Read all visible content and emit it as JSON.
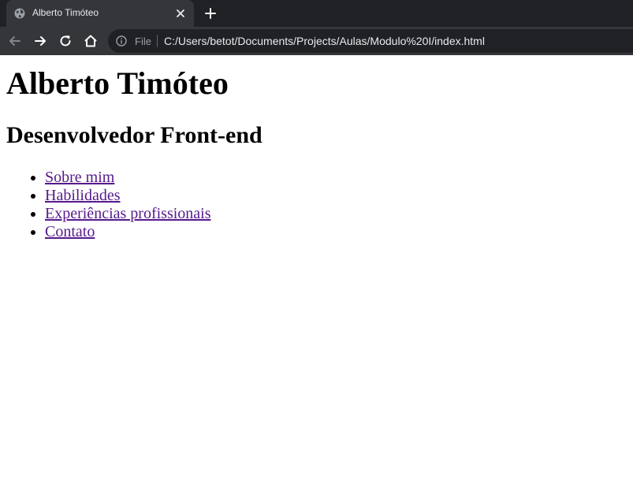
{
  "browser": {
    "tab": {
      "title": "Alberto Timóteo",
      "favicon": "globe-icon",
      "close_icon": "close-icon"
    },
    "new_tab_icon": "plus-icon",
    "toolbar": {
      "back_icon": "back-arrow-icon",
      "forward_icon": "forward-arrow-icon",
      "reload_icon": "reload-icon",
      "home_icon": "home-icon"
    },
    "omnibox": {
      "info_icon": "info-icon",
      "scheme_label": "File",
      "url": "C:/Users/betot/Documents/Projects/Aulas/Modulo%20I/index.html"
    },
    "colors": {
      "tabstrip": "#202124",
      "toolbar": "#35363a",
      "link_visited": "#551a8b"
    }
  },
  "page": {
    "title": "Alberto Timóteo",
    "subtitle": "Desenvolvedor Front-end",
    "nav": [
      {
        "label": "Sobre mim"
      },
      {
        "label": "Habilidades"
      },
      {
        "label": "Experiências profissionais"
      },
      {
        "label": "Contato"
      }
    ]
  }
}
